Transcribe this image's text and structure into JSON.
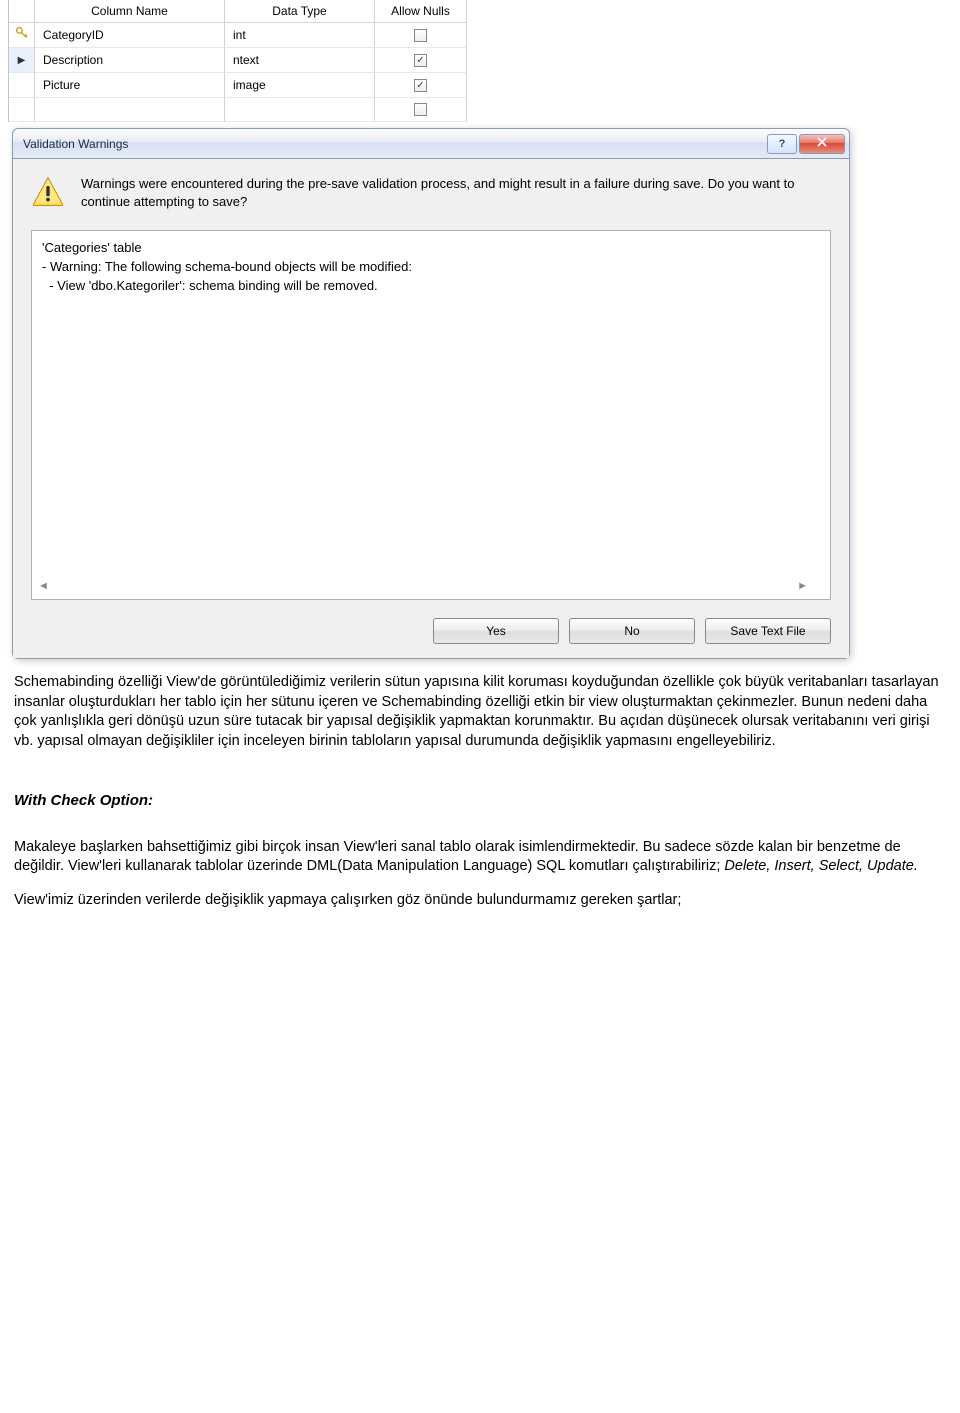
{
  "table": {
    "headers": {
      "name": "Column Name",
      "type": "Data Type",
      "null": "Allow Nulls"
    },
    "rows": [
      {
        "name": "CategoryID",
        "type": "int",
        "null": false,
        "key": true
      },
      {
        "name": "Description",
        "type": "ntext",
        "null": true,
        "selected": true
      },
      {
        "name": "Picture",
        "type": "image",
        "null": true
      },
      {
        "name": "",
        "type": "",
        "null_empty": true
      }
    ]
  },
  "dialog": {
    "title": "Validation Warnings",
    "message": "Warnings were encountered during the pre-save validation process, and might result in a failure during save. Do you want to continue attempting to save?",
    "details_line1": "'Categories' table",
    "details_line2": "- Warning: The following schema-bound objects will be modified:",
    "details_line3": "  - View 'dbo.Kategoriler': schema binding will be removed.",
    "buttons": {
      "yes": "Yes",
      "no": "No",
      "save": "Save Text File"
    },
    "scroll_left": "◄",
    "scroll_right": "►"
  },
  "article": {
    "p1": "Schemabinding özelliği View'de görüntülediğimiz verilerin sütun yapısına kilit koruması koyduğundan özellikle çok büyük veritabanları tasarlayan insanlar oluşturdukları her tablo için her sütunu içeren ve Schemabinding özelliği etkin bir view oluşturmaktan çekinmezler. Bunun nedeni daha çok yanlışlıkla geri dönüşü uzun süre tutacak bir yapısal değişiklik yapmaktan korunmaktır. Bu açıdan düşünecek olursak veritabanını veri girişi vb. yapısal olmayan değişikliler için inceleyen birinin tabloların yapısal durumunda değişiklik yapmasını engelleyebiliriz.",
    "heading": "With Check Option:",
    "p2a": "Makaleye başlarken bahsettiğimiz gibi birçok insan View'leri sanal tablo olarak isimlendirmektedir. Bu sadece sözde kalan bir benzetme de değildir. View'leri kullanarak tablolar üzerinde DML(Data Manipulation Language) SQL komutları çalıştırabiliriz; ",
    "p2b": "Delete, Insert, Select, Update.",
    "p3": "View'imiz üzerinden verilerde değişiklik yapmaya çalışırken göz önünde bulundurmamız gereken şartlar;"
  }
}
